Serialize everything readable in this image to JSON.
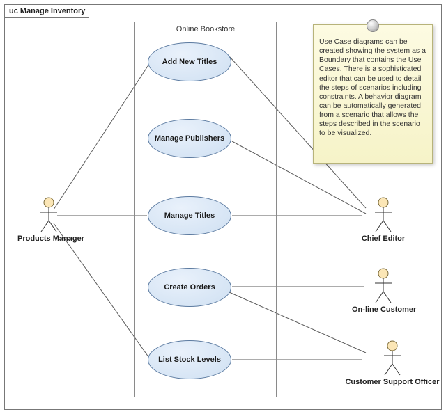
{
  "diagram": {
    "kind_keyword": "uc",
    "title": "Manage Inventory",
    "system_name": "Online Bookstore",
    "use_cases": [
      {
        "id": "uc_add_titles",
        "label": "Add New Titles"
      },
      {
        "id": "uc_manage_publishers",
        "label": "Manage Publishers"
      },
      {
        "id": "uc_manage_titles",
        "label": "Manage Titles"
      },
      {
        "id": "uc_create_orders",
        "label": "Create Orders"
      },
      {
        "id": "uc_list_stock",
        "label": "List Stock Levels"
      }
    ],
    "actors": [
      {
        "id": "actor_products_manager",
        "label": "Products Manager"
      },
      {
        "id": "actor_chief_editor",
        "label": "Chief Editor"
      },
      {
        "id": "actor_online_customer",
        "label": "On-line Customer"
      },
      {
        "id": "actor_customer_support_officer",
        "label": "Customer Support Officer"
      }
    ],
    "associations": [
      {
        "from": "actor_products_manager",
        "to": "uc_add_titles"
      },
      {
        "from": "actor_products_manager",
        "to": "uc_manage_titles"
      },
      {
        "from": "actor_products_manager",
        "to": "uc_list_stock"
      },
      {
        "from": "actor_chief_editor",
        "to": "uc_add_titles"
      },
      {
        "from": "actor_chief_editor",
        "to": "uc_manage_publishers"
      },
      {
        "from": "actor_chief_editor",
        "to": "uc_manage_titles"
      },
      {
        "from": "actor_online_customer",
        "to": "uc_create_orders"
      },
      {
        "from": "actor_customer_support_officer",
        "to": "uc_create_orders"
      },
      {
        "from": "actor_customer_support_officer",
        "to": "uc_list_stock"
      }
    ],
    "note_text": "Use Case diagrams can be created showing the system as a Boundary that contains the Use Cases. There is a sophisticated editor that can be used to detail the steps of scenarios including constraints. A behavior diagram can be automatically generated from a scenario that allows the steps described in the scenario to be visualized."
  }
}
